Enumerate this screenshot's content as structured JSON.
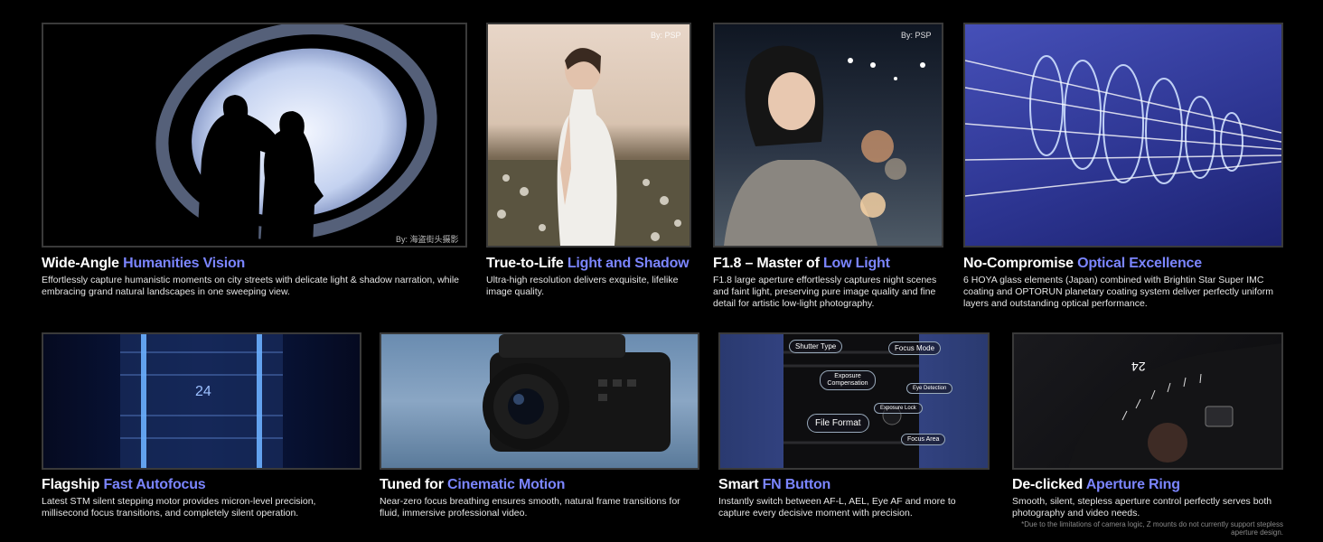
{
  "features": [
    {
      "title_plain": "Wide-Angle ",
      "title_hl": "Humanities Vision",
      "desc": "Effortlessly capture humanistic moments on city streets with delicate light & shadow narration, while embracing grand natural landscapes in one sweeping view.",
      "credit": "By: 海盗街头摄影"
    },
    {
      "title_plain": "True-to-Life ",
      "title_hl": "Light and Shadow",
      "desc": "Ultra-high resolution delivers exquisite, lifelike image quality.",
      "credit": "By: PSP"
    },
    {
      "title_plain": "F1.8 – Master of ",
      "title_hl": "Low Light",
      "desc": "F1.8 large aperture effortlessly captures night scenes and faint light, preserving pure image quality and fine detail for artistic low-light photography.",
      "credit": "By: PSP"
    },
    {
      "title_plain": "No-Compromise ",
      "title_hl": "Optical Excellence",
      "desc": "6 HOYA glass elements (Japan) combined with Brightin Star Super IMC coating and OPTORUN planetary coating system deliver perfectly uniform layers and outstanding optical performance."
    },
    {
      "title_plain": "Flagship ",
      "title_hl": "Fast Autofocus",
      "desc": "Latest STM silent stepping motor provides micron-level precision, millisecond focus transitions, and completely silent operation.",
      "lens_mark": "24"
    },
    {
      "title_plain": "Tuned for ",
      "title_hl": "Cinematic Motion",
      "desc": "Near-zero focus breathing ensures smooth, natural frame transitions for fluid, immersive professional video."
    },
    {
      "title_plain": "Smart ",
      "title_hl": "FN Button",
      "desc": "Instantly switch between AF-L, AEL, Eye AF and more to capture every decisive moment with precision.",
      "labels": [
        "Shutter Type",
        "Focus Mode",
        "Exposure Compensation",
        "Eye Detection",
        "Exposure Lock",
        "File Format",
        "Focus Area"
      ]
    },
    {
      "title_plain": "De-clicked ",
      "title_hl": "Aperture Ring",
      "desc": "Smooth, silent, stepless aperture control perfectly serves both photography and video needs.",
      "lens_mark": "24"
    }
  ],
  "footnote": "*Due to the limitations of camera logic, Z mounts do not currently support stepless aperture design.",
  "colors": {
    "highlight": "#7b85ff",
    "background": "#000000"
  }
}
